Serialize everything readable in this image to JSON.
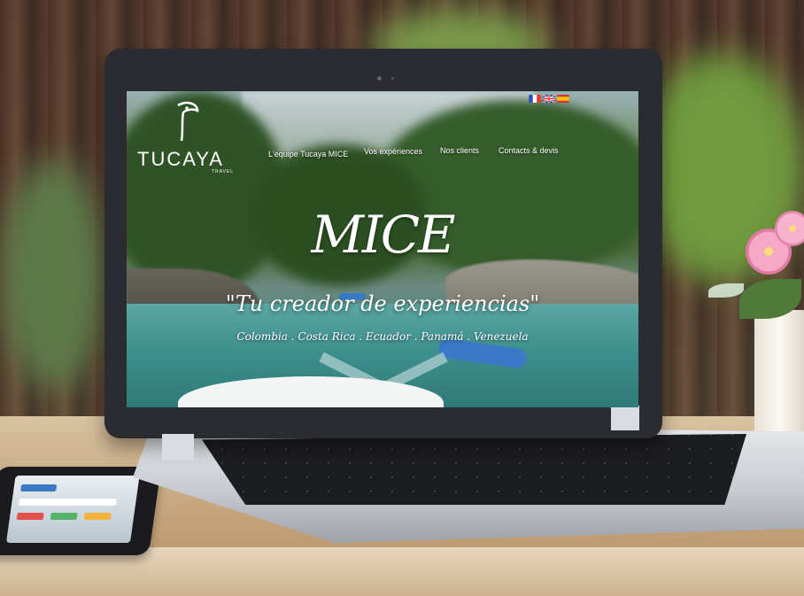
{
  "site": {
    "logo_text": "TUCAYA",
    "logo_sub": "TRAVEL",
    "nav": [
      {
        "label": "L'equipe Tucaya MICE"
      },
      {
        "label": "Vos expériences"
      },
      {
        "label": "Nos clients"
      },
      {
        "label": "Contacts & devis"
      }
    ],
    "languages": [
      "fr-flag-icon",
      "uk-flag-icon",
      "es-flag-icon"
    ]
  },
  "hero": {
    "title": "MICE",
    "quote": "\"Tu creador de experiencias\"",
    "countries": "Colombia . Costa Rica . Ecuador . Panamá . Venezuela"
  },
  "colors": {
    "accent": "#ffffff",
    "river": "#3b8e8c",
    "raft": "#3a79c6"
  }
}
